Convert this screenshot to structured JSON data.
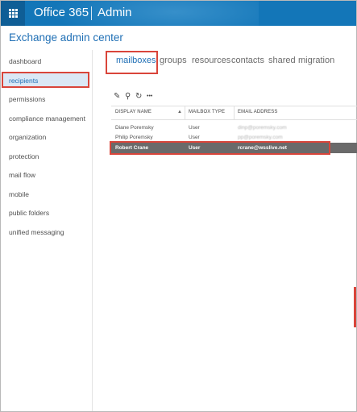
{
  "topbar": {
    "brand": "Office 365",
    "app": "Admin",
    "icons": {
      "waffle": "app-launcher-icon"
    }
  },
  "header": {
    "title": "Exchange admin center"
  },
  "nav": {
    "items": [
      {
        "label": "dashboard"
      },
      {
        "label": "recipients",
        "selected": true
      },
      {
        "label": "permissions"
      },
      {
        "label": "compliance management"
      },
      {
        "label": "organization"
      },
      {
        "label": "protection"
      },
      {
        "label": "mail flow"
      },
      {
        "label": "mobile"
      },
      {
        "label": "public folders"
      },
      {
        "label": "unified messaging"
      }
    ]
  },
  "tabs": [
    {
      "label": "mailboxes",
      "active": true
    },
    {
      "label": "groups"
    },
    {
      "label": "resources"
    },
    {
      "label": "contacts"
    },
    {
      "label": "shared"
    },
    {
      "label": "migration"
    }
  ],
  "toolbar": {
    "icons": [
      "edit-icon",
      "search-icon",
      "refresh-icon",
      "more-icon"
    ],
    "glyphs": {
      "edit": "✎",
      "search": "⚲",
      "refresh": "↻",
      "more": "•••"
    }
  },
  "table": {
    "columns": [
      "DISPLAY NAME",
      "MAILBOX TYPE",
      "EMAIL ADDRESS"
    ],
    "sort_glyph": "▲",
    "rows": [
      {
        "name": "Diane Poremsky",
        "type": "User",
        "email": "dinp@poremsky.com",
        "selected": false,
        "email_obscured": true
      },
      {
        "name": "Philip Poremsky",
        "type": "User",
        "email": "pp@poremsky.com",
        "selected": false,
        "email_obscured": true
      },
      {
        "name": "Robert Crane",
        "type": "User",
        "email": "rcrane@wsslive.net",
        "selected": true,
        "email_obscured": false
      }
    ]
  },
  "colors": {
    "topbar": "#1376b8",
    "accent": "#1f6fb5",
    "highlight": "#d9453a",
    "selected_row": "#6a6a6a"
  }
}
